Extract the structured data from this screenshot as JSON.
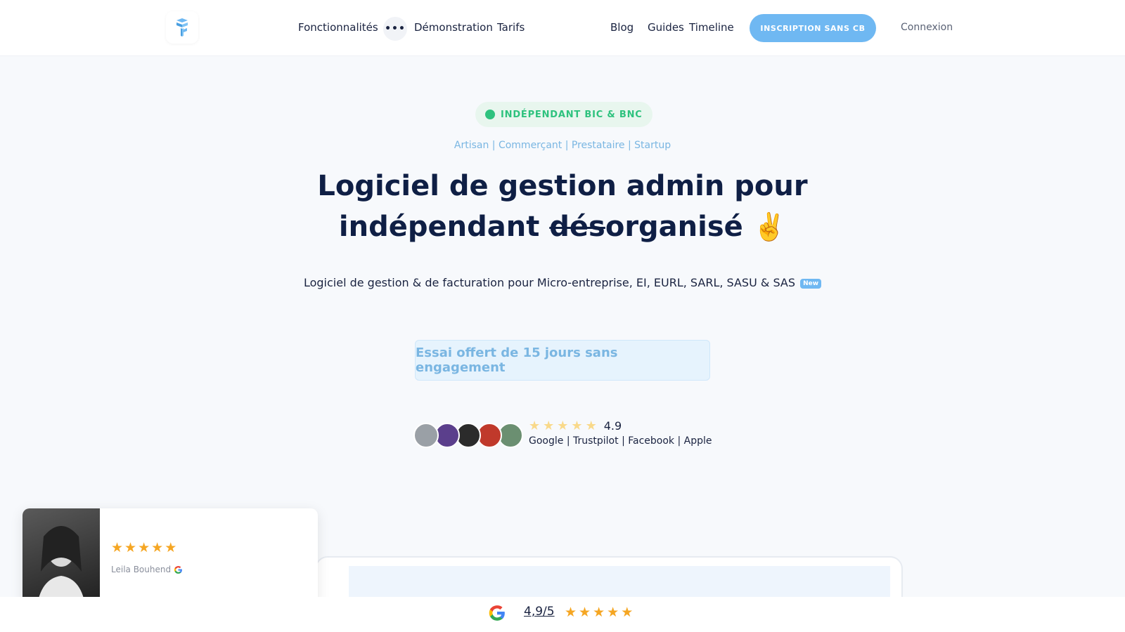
{
  "nav": {
    "items_left": [
      "Fonctionnalités",
      "Démonstration",
      "Tarifs"
    ],
    "items_right": [
      "Blog",
      "Guides",
      "Timeline"
    ],
    "cta_label": "INSCRIPTION SANS CB",
    "login_label": "Connexion"
  },
  "hero": {
    "badge": "INDÉPENDANT BIC & BNC",
    "segments": "Artisan | Commerçant | Prestataire | Startup",
    "headline_line1": "Logiciel de gestion admin pour",
    "headline_line2_prefix": "indépendant ",
    "headline_strike": "dés",
    "headline_line2_suffix": "organisé",
    "headline_emoji": "✌️",
    "subtitle": "Logiciel de gestion & de facturation pour Micro-entreprise, EI, EURL, SARL, SASU & SAS",
    "new_tag": "New",
    "trial_label": "Essai offert de 15 jours sans engagement"
  },
  "social_proof": {
    "rating": "4.9",
    "platforms": "Google | Trustpilot | Facebook | Apple",
    "avatar_colors": [
      "#9aa0a6",
      "#5b3f8c",
      "#2b2b2b",
      "#c0392b",
      "#6b8f71"
    ]
  },
  "review": {
    "name": "Leila Bouhend",
    "stars": 5
  },
  "bottom_bar": {
    "rating": "4,9/5",
    "stars": 5
  },
  "colors": {
    "accent": "#6fb8f2",
    "green": "#2ec27e",
    "navy": "#0f1f45",
    "gold": "#f5a623"
  }
}
